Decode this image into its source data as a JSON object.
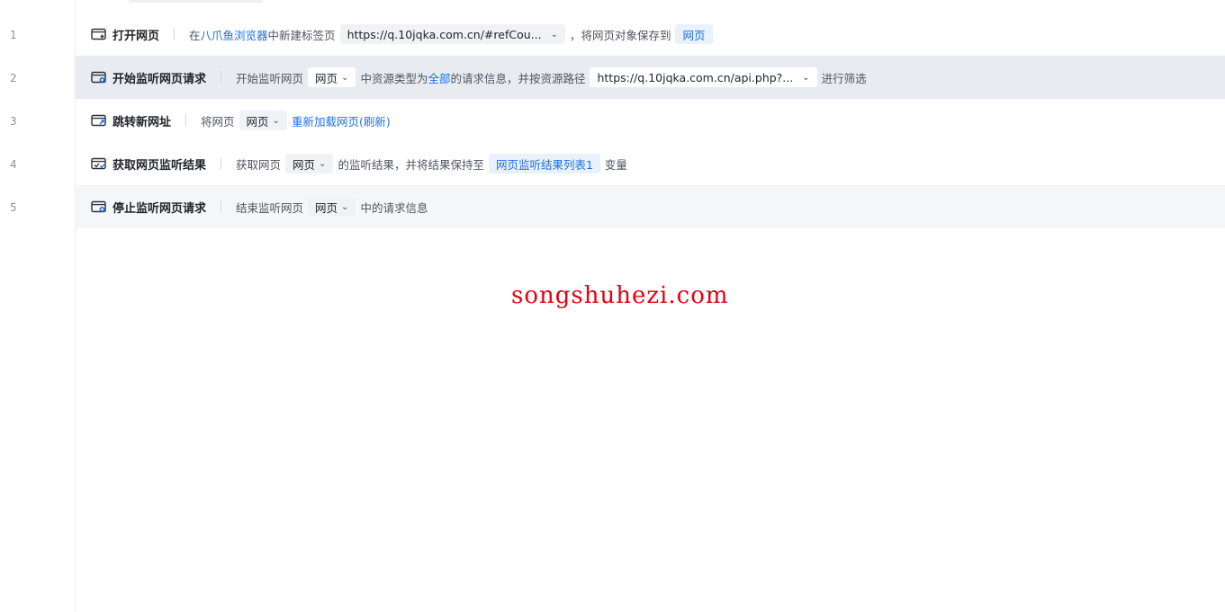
{
  "line_numbers": [
    "1",
    "2",
    "3",
    "4",
    "5"
  ],
  "steps": [
    {
      "title": "打开网页",
      "text_in": "在",
      "browser_link": "八爪鱼浏览器",
      "text_new_tab": "中新建标签页",
      "url": "https://q.10jqka.com.cn/#refCou...",
      "text_save": "，将网页对象保存到",
      "var": "网页"
    },
    {
      "title": "开始监听网页请求",
      "text_start": "开始监听网页",
      "page_select": "网页",
      "text_resource": "中资源类型为",
      "type_link": "全部",
      "text_request": "的请求信息，并按资源路径",
      "url": "https://q.10jqka.com.cn/api.php?...",
      "text_filter": "进行筛选"
    },
    {
      "title": "跳转新网址",
      "text_page": "将网页",
      "page_select": "网页",
      "action_link": "重新加载网页(刷新)"
    },
    {
      "title": "获取网页监听结果",
      "text_get": "获取网页",
      "page_select": "网页",
      "text_result": "的监听结果，并将结果保持至",
      "var": "网页监听结果列表1",
      "text_var": "变量"
    },
    {
      "title": "停止监听网页请求",
      "text_end": "结束监听网页",
      "page_select": "网页",
      "text_info": "中的请求信息"
    }
  ],
  "watermark": "songshuhezi.com",
  "icons": {
    "chevron": "chevron-down-icon",
    "open_page": "browser-plus-icon",
    "listen": "browser-record-icon",
    "navigate": "browser-arrow-icon",
    "result": "browser-check-icon",
    "stop": "browser-stop-icon"
  },
  "colors": {
    "link": "#1f6fe5",
    "selected_row": "#e8ebf0",
    "hover_row": "#f4f6f9",
    "watermark": "#e60012"
  }
}
